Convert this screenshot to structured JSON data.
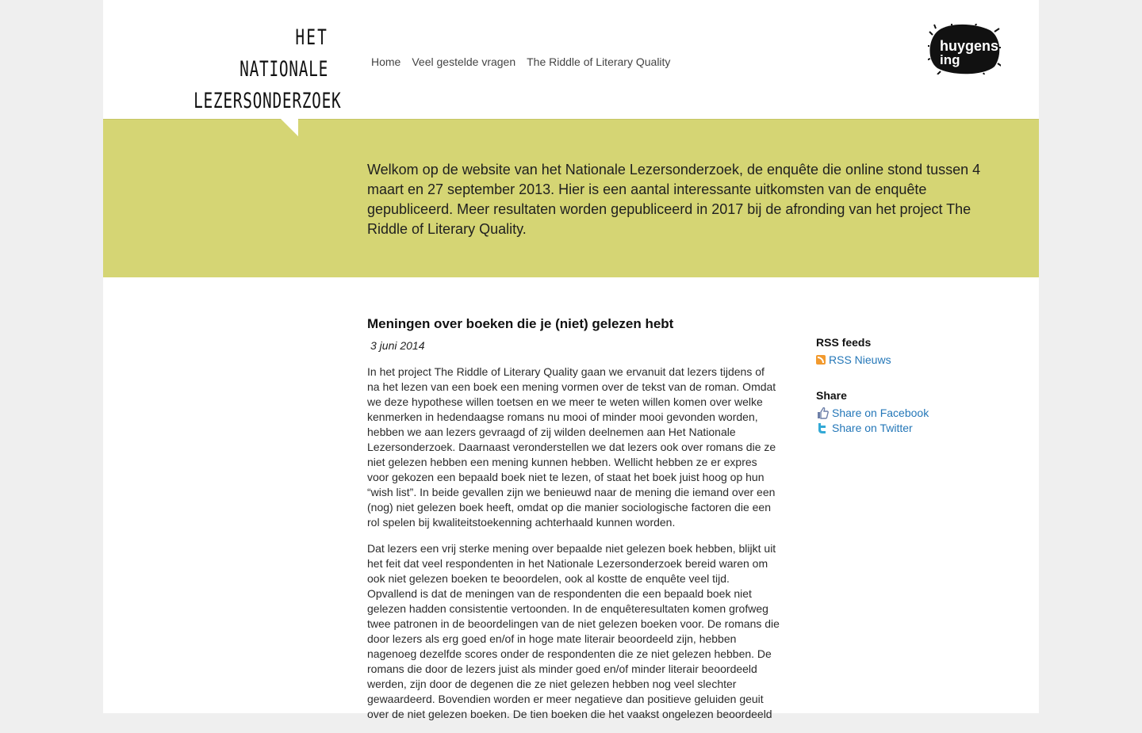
{
  "header": {
    "logo_lines": [
      "HET",
      "NATIONALE",
      "LEZERSONDERZOEK"
    ],
    "nav": [
      "Home",
      "Veel gestelde vragen",
      "The Riddle of Literary Quality"
    ],
    "partner_logo_text": [
      "huygens",
      "ing"
    ]
  },
  "intro": {
    "text": "Welkom op de website van het Nationale Lezersonderzoek, de enquête die online stond tussen 4 maart en 27 september 2013. Hier is een aantal interessante uitkomsten van de enquête gepubliceerd. Meer resultaten worden gepubliceerd in 2017 bij de afronding van het project The Riddle of Literary Quality."
  },
  "article": {
    "title": "Meningen over boeken die je (niet) gelezen hebt",
    "date": "3 juni 2014",
    "paragraphs": [
      "In het project The Riddle of Literary Quality gaan we ervanuit dat lezers tijdens of na het lezen van een boek een mening vormen over de tekst van de roman. Omdat we deze hypothese willen toetsen en we meer te weten willen komen over welke kenmerken in hedendaagse romans nu mooi of minder mooi gevonden worden, hebben we aan lezers gevraagd of zij wilden deelnemen aan Het Nationale Lezersonderzoek. Daarnaast veronderstellen we dat lezers ook over romans die ze niet gelezen hebben een mening kunnen hebben. Wellicht hebben ze er expres voor gekozen een bepaald boek niet te lezen, of staat het boek juist hoog op hun “wish list”. In beide gevallen zijn we benieuwd naar de mening die iemand over een (nog) niet gelezen boek heeft, omdat op die manier sociologische factoren die een rol spelen bij kwaliteitstoekenning achterhaald kunnen worden.",
      "Dat lezers een vrij sterke mening over bepaalde niet gelezen boek hebben, blijkt uit het feit dat veel respondenten in het Nationale Lezersonderzoek bereid waren om ook niet gelezen boeken te beoordelen, ook al kostte de enquête veel tijd. Opvallend is dat de meningen van de respondenten die een bepaald boek niet gelezen hadden consistentie vertoonden. In de enquêteresultaten komen grofweg twee patronen in de beoordelingen van de niet gelezen boeken voor. De romans die door lezers als erg goed en/of in hoge mate literair beoordeeld zijn, hebben nagenoeg dezelfde scores onder de respondenten die ze niet gelezen hebben. De romans die door de lezers juist als minder goed en/of minder literair beoordeeld werden, zijn door de degenen die ze niet gelezen hebben nog veel slechter gewaardeerd. Bovendien worden er meer negatieve dan positieve geluiden geuit over de niet gelezen boeken. De tien boeken die het vaakst ongelezen beoordeeld"
    ]
  },
  "sidebar": {
    "rss_heading": "RSS feeds",
    "rss_link": "RSS Nieuws",
    "share_heading": "Share",
    "share_facebook": "Share on Facebook",
    "share_twitter": "Share on Twitter"
  },
  "colors": {
    "band": "#d5d574",
    "link": "#2477b8",
    "rss": "#f29a2e"
  }
}
